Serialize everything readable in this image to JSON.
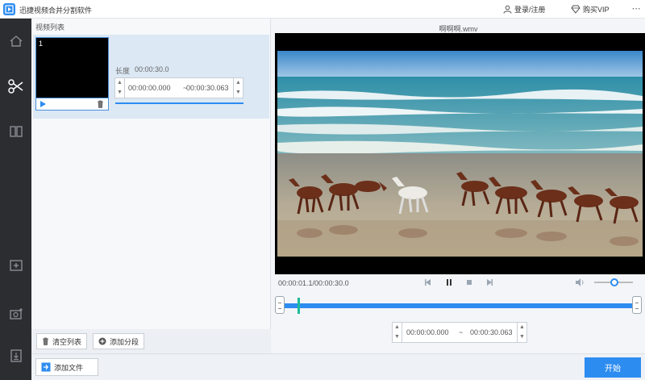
{
  "app": {
    "title": "迅捷视频合并分割软件",
    "login_label": "登录/注册",
    "vip_label": "购买VIP"
  },
  "sidebar": {
    "items": [
      {
        "icon": "home-icon"
      },
      {
        "icon": "scissors-icon",
        "active": true
      },
      {
        "icon": "split-icon"
      },
      {
        "icon": "add-folder-icon"
      },
      {
        "icon": "add-photo-icon"
      },
      {
        "icon": "export-icon"
      }
    ]
  },
  "list": {
    "title": "视频列表",
    "clips": [
      {
        "index": "1",
        "length_label": "长度",
        "length_value": "00:00:30.0",
        "start": "00:00:00.000",
        "end": "00:00:30.063"
      }
    ],
    "clear_label": "清空列表",
    "add_segment_label": "添加分段"
  },
  "footer": {
    "add_file_label": "添加文件",
    "start_label": "开始"
  },
  "preview": {
    "file_name": "啊啊啊.wmv",
    "time_readout": "00:00:01.1/00:00:30.0",
    "range_start": "00:00:00.000",
    "range_end": "00:00:30.063",
    "range_dash": "~"
  },
  "colors": {
    "accent": "#2d8cf0",
    "sidebar_bg": "#2b2d31",
    "playhead": "#1bbc9b"
  }
}
